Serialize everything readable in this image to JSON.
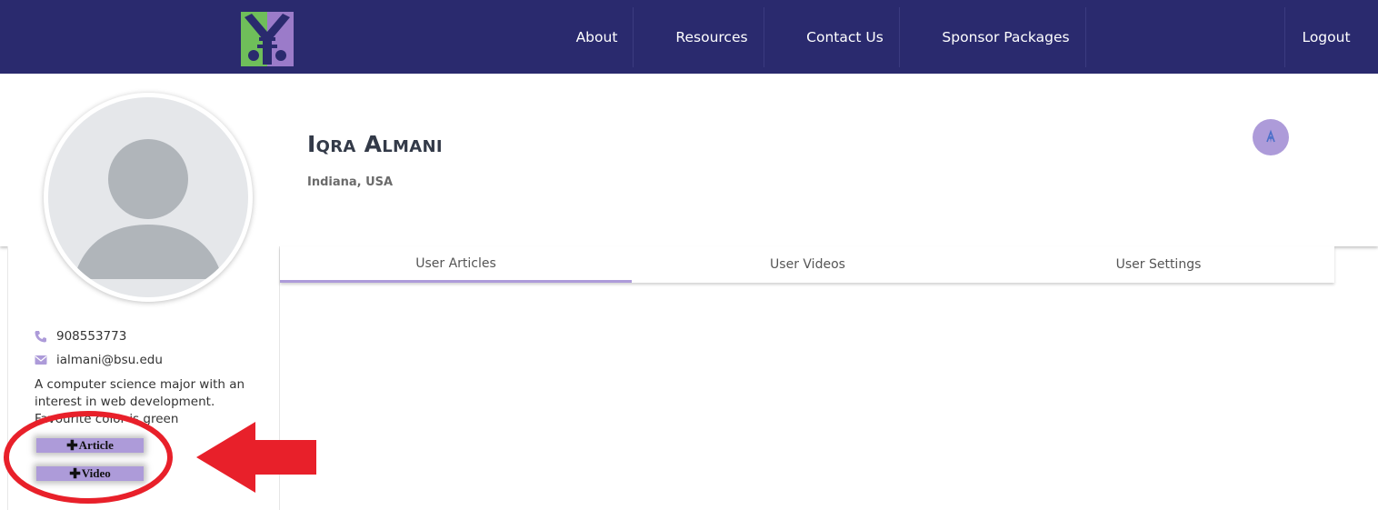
{
  "nav": {
    "links": [
      "About",
      "Resources",
      "Contact Us",
      "Sponsor Packages"
    ],
    "logout": "Logout"
  },
  "profile": {
    "name": "Iqra Almani",
    "location": "Indiana, USA",
    "phone": "908553773",
    "email": "ialmani@bsu.edu",
    "bio": "A computer science major with an interest in web development. Favourite color is green"
  },
  "tabs": [
    "User Articles",
    "User Videos",
    "User Settings"
  ],
  "actions": {
    "article": "Article",
    "video": "Video"
  },
  "colors": {
    "navbar": "#2a2a6e",
    "accent": "#ad9bd9",
    "annotation": "#e8202a"
  },
  "icons": [
    "logo-icon",
    "phone-icon",
    "email-icon",
    "badge-icon",
    "plus-icon",
    "arrow-annotation",
    "circle-annotation"
  ]
}
